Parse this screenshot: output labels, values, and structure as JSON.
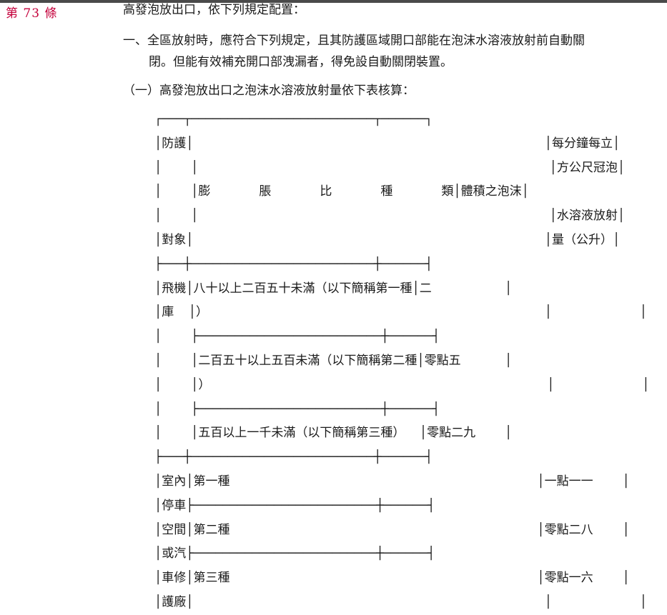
{
  "article": {
    "number": "第 73 條"
  },
  "text": {
    "intro": "高發泡放出口，依下列規定配置：",
    "item1_line1": "一、全區放射時，應符合下列規定，且其防護區域開口部能在泡沫水溶液放射前自動關",
    "item1_line2": "閉。但能有效補充開口部洩漏者，得免設自動關閉裝置。",
    "sub1": "（一）高發泡放出口之泡沫水溶液放射量依下表核算："
  },
  "table_lines": [
    "┌───┬─────────────────────────┬──────┐",
    "│防護│                                                │每分鐘每立│",
    "│    │                                                │方公尺冠泡│",
    "│    │膨　　　　脹　　　　比　　　　種　　　　類│體積之泡沫│",
    "│    │                                                │水溶液放射│",
    "│對象│                                                │量（公升）│",
    "├───┼─────────────────────────┼──────┤",
    "│飛機│八十以上二百五十未滿（以下簡稱第一種│二          │",
    "│庫  │）                                              │            │",
    "│    ├─────────────────────────┼──────┤",
    "│    │二百五十以上五百未滿（以下簡稱第二種│零點五      │",
    "│    │）                                              │            │",
    "│    ├─────────────────────────┼──────┤",
    "│    │五百以上一千未滿（以下簡稱第三種）  │零點二九    │",
    "├───┼─────────────────────────┼──────┤",
    "│室內│第一種                                          │一點一一    │",
    "│停車├─────────────────────────┼──────┤",
    "│空間│第二種                                          │零點二八    │",
    "│或汽├─────────────────────────┼──────┤",
    "│車修│第三種                                          │零點一六    │",
    "│護廠│                                                │            │"
  ]
}
